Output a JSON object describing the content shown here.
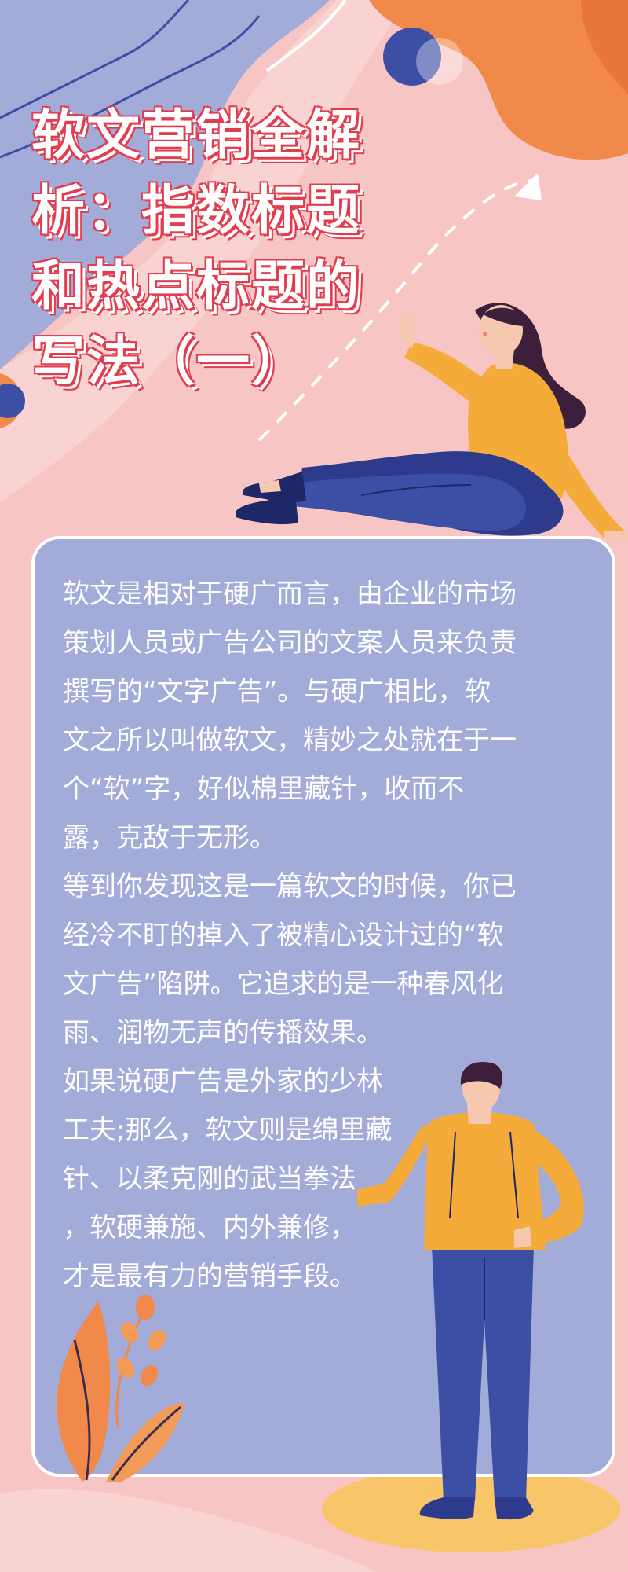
{
  "poster": {
    "title_lines": [
      "软文营销全解",
      "析：指数标题",
      "和热点标题的",
      "写法（一）"
    ],
    "paragraphs": [
      {
        "lines": [
          "软文是相对于硬广而言，由企业的市场",
          "策划人员或广告公司的文案人员来负责",
          "撰写的“文字广告”。与硬广相比，软",
          "文之所以叫做软文，精妙之处就在于一",
          "个“软”字，好似棉里藏针，收而不",
          "露，克敌于无形。"
        ]
      },
      {
        "lines": [
          "等到你发现这是一篇软文的时候，你已",
          "经冷不盯的掉入了被精心设计过的“软",
          "文广告”陷阱。它追求的是一种春风化",
          "雨、润物无声的传播效果。"
        ]
      },
      {
        "lines": [
          "如果说硬广告是外家的少林",
          "工夫;那么，软文则是绵里藏",
          "针、以柔克刚的武当拳法",
          "，软硬兼施、内外兼修，",
          "才是最有力的营销手段。"
        ]
      }
    ]
  },
  "colors": {
    "background": "#f7c6c4",
    "card": "#a3abd9",
    "title_outline": "#e23c4e",
    "accent_orange": "#f29a57",
    "accent_blue": "#3d4fa4",
    "sweater_yellow": "#f4ab3a"
  }
}
